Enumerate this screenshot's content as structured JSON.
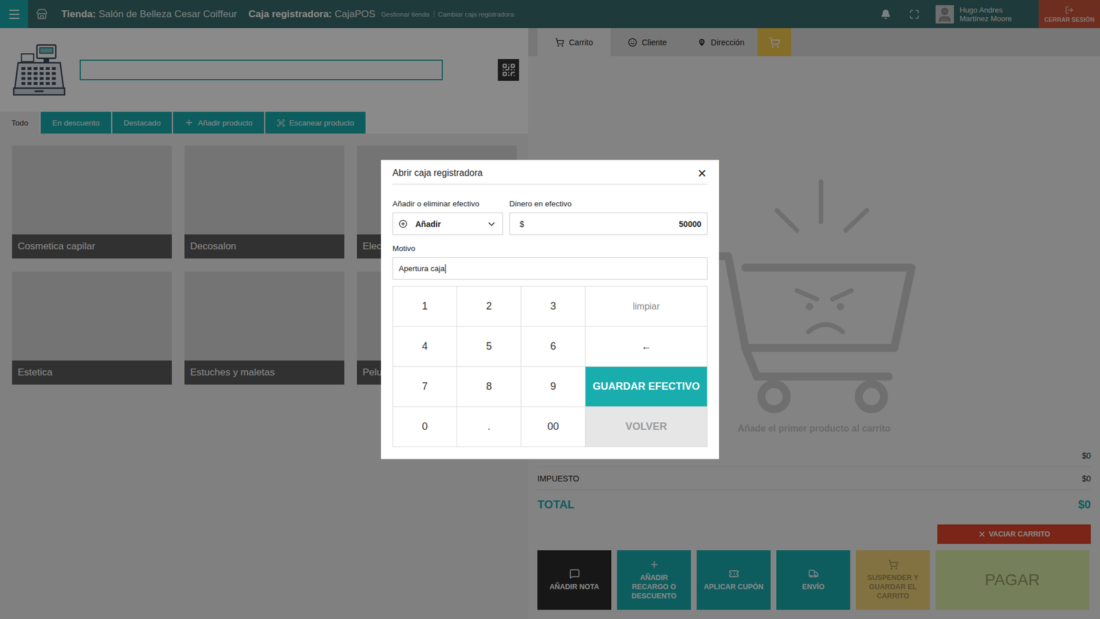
{
  "topbar": {
    "store_label": "Tienda:",
    "store_name": "Salón de Belleza Cesar Coiffeur",
    "register_label": "Caja registradora:",
    "register_name": "CajaPOS",
    "links": [
      "Gestionar tienda",
      "Cambiar caja registradora"
    ],
    "user": "Hugo Andres Martínez Moore",
    "logout": "CERRAR SESIÓN"
  },
  "search": {
    "value": ""
  },
  "filter_tabs": [
    {
      "label": "Todo",
      "selected": true,
      "kind": "plain"
    },
    {
      "label": "En descuento",
      "selected": false,
      "kind": "plain"
    },
    {
      "label": "Destacado",
      "selected": false,
      "kind": "plain"
    },
    {
      "label": "Añadir producto",
      "selected": false,
      "kind": "add"
    },
    {
      "label": "Escanear producto",
      "selected": false,
      "kind": "scan"
    }
  ],
  "categories": [
    {
      "label": "Cosmetica capilar"
    },
    {
      "label": "Decosalon"
    },
    {
      "label": "Elec"
    },
    {
      "label": "Estetica"
    },
    {
      "label": "Estuches y maletas"
    },
    {
      "label": "Pelu"
    }
  ],
  "cart_tabs": [
    {
      "label": "Carrito",
      "selected": true,
      "kind": "cart"
    },
    {
      "label": "Cliente",
      "selected": false,
      "kind": "customer"
    },
    {
      "label": "Dirección",
      "selected": false,
      "kind": "address"
    }
  ],
  "cart": {
    "empty_message": "Añade el primer producto al carrito",
    "subtotal": "$0",
    "tax_label": "IMPUESTO",
    "tax": "$0",
    "total_label": "TOTAL",
    "total": "$0",
    "clear_label": "VACIAR CARRITO"
  },
  "actions": [
    {
      "label": "AÑADIR NOTA",
      "kind": "note",
      "disabled": false,
      "color": "#2b2b2b"
    },
    {
      "label": "AÑADIR RECARGO O DESCUENTO",
      "kind": "adjust",
      "disabled": false,
      "color": "#1aadae"
    },
    {
      "label": "APLICAR CUPÓN",
      "kind": "coupon",
      "disabled": false,
      "color": "#1aadae"
    },
    {
      "label": "ENVÍO",
      "kind": "shipping",
      "disabled": false,
      "color": "#1aadae"
    },
    {
      "label": "SUSPENDER Y GUARDAR EL CARRITO",
      "kind": "suspend",
      "disabled": true,
      "color": "#f0d27a"
    },
    {
      "label": "PAGAR",
      "kind": "pay",
      "disabled": true,
      "color": "#d8eaa6"
    }
  ],
  "modal": {
    "title": "Abrir caja registradora",
    "close": "×",
    "mode_label": "Añadir o eliminar efectivo",
    "mode_value": "Añadir",
    "cash_label": "Dinero en efectivo",
    "currency": "$",
    "amount": "50000",
    "reason_label": "Motivo",
    "reason_value": "Apertura caja",
    "keys": [
      {
        "label": "1",
        "kind": "digit"
      },
      {
        "label": "2",
        "kind": "digit"
      },
      {
        "label": "3",
        "kind": "digit"
      },
      {
        "label": "limpiar",
        "kind": "clear"
      },
      {
        "label": "4",
        "kind": "digit"
      },
      {
        "label": "5",
        "kind": "digit"
      },
      {
        "label": "6",
        "kind": "digit"
      },
      {
        "label": "←",
        "kind": "backspace"
      },
      {
        "label": "7",
        "kind": "digit"
      },
      {
        "label": "8",
        "kind": "digit"
      },
      {
        "label": "9",
        "kind": "digit"
      },
      {
        "label": "GUARDAR EFECTIVO",
        "kind": "primary"
      },
      {
        "label": "0",
        "kind": "digit"
      },
      {
        "label": ".",
        "kind": "digit"
      },
      {
        "label": "00",
        "kind": "digit"
      },
      {
        "label": "VOLVER",
        "kind": "secondary"
      }
    ]
  }
}
